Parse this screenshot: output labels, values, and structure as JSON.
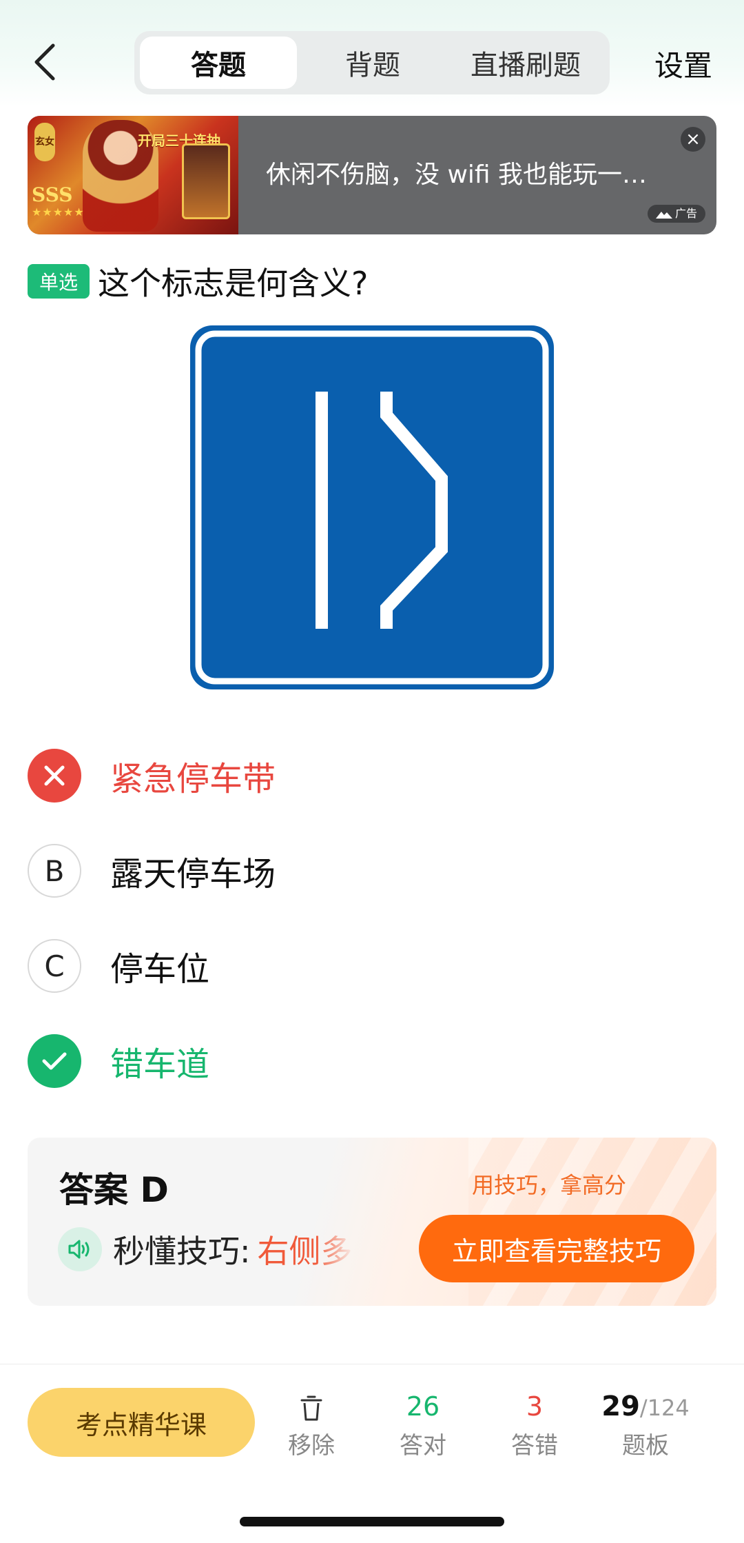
{
  "header": {
    "tabs": [
      {
        "label": "答题",
        "active": true
      },
      {
        "label": "背题",
        "active": false
      },
      {
        "label": "直播刷题",
        "active": false
      }
    ],
    "settings_label": "设置",
    "back_icon": "chevron-left-icon"
  },
  "ad": {
    "text": "休闲不伤脑，没 wifi 我也能玩一…",
    "label": "广告",
    "image_text": {
      "banner": "开局三十连抽",
      "rank": "SSS",
      "tag": "玄女"
    }
  },
  "question": {
    "type_badge": "单选",
    "text": "这个标志是何含义?"
  },
  "options": [
    {
      "key": "A",
      "text": "紧急停车带",
      "state": "wrong"
    },
    {
      "key": "B",
      "text": "露天停车场",
      "state": "normal"
    },
    {
      "key": "C",
      "text": "停车位",
      "state": "normal"
    },
    {
      "key": "D",
      "text": "错车道",
      "state": "correct"
    }
  ],
  "answer": {
    "title": "答案 D",
    "tip_label": "秒懂技巧:",
    "tip_value": "右侧多",
    "slogan": "用技巧，拿高分",
    "button_label": "立即查看完整技巧"
  },
  "bottom_bar": {
    "course_button": "考点精华课",
    "remove": {
      "label": "移除"
    },
    "correct": {
      "count": "26",
      "label": "答对"
    },
    "wrong": {
      "count": "3",
      "label": "答错"
    },
    "board": {
      "current": "29",
      "total": "/124",
      "label": "题板"
    }
  },
  "colors": {
    "accent_green": "#17b66e",
    "error_red": "#e8473f",
    "sign_blue": "#0a5fae",
    "cta_orange": "#ff6a0e",
    "course_yellow": "#fbd36b"
  }
}
